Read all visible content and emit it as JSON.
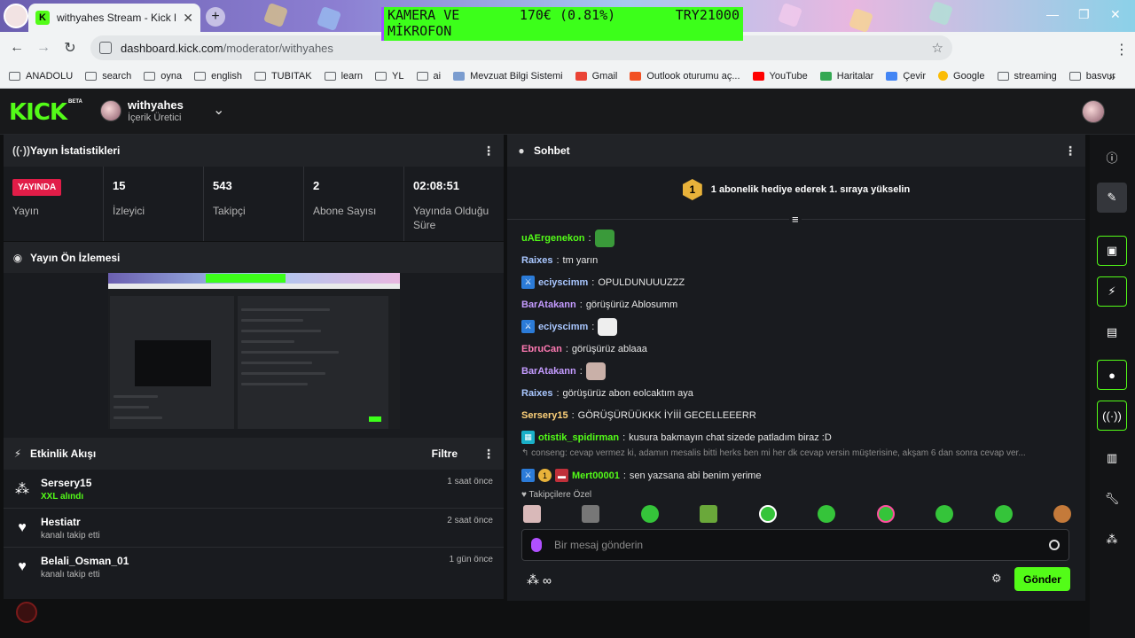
{
  "browser": {
    "tab_title": "withyahes Stream - Kick Dashbo",
    "tab_favicon": "K",
    "url_host": "dashboard.kick.com",
    "url_path": "/moderator/withyahes",
    "overlay": {
      "line1_left": "KAMERA VE",
      "line1_mid": "170€ (0.81%)",
      "line1_right": "TRY21000",
      "line2": "MİKROFON"
    },
    "bookmarks": [
      "ANADOLU",
      "search",
      "oyna",
      "english",
      "TUBITAK",
      "learn",
      "YL",
      "ai",
      "Mevzuat Bilgi Sistemi",
      "Gmail",
      "Outlook oturumu aç...",
      "YouTube",
      "Haritalar",
      "Çevir",
      "Google",
      "streaming",
      "basvur"
    ]
  },
  "header": {
    "logo": "KICK",
    "beta": "BETA",
    "channel_name": "withyahes",
    "channel_role": "İçerik Üretici"
  },
  "stats_panel": {
    "title": "Yayın İstatistikleri",
    "live_badge": "YAYINDA",
    "live_label": "Yayın",
    "viewers_value": "15",
    "viewers_label": "İzleyici",
    "followers_value": "543",
    "followers_label": "Takipçi",
    "subs_value": "2",
    "subs_label": "Abone Sayısı",
    "uptime_value": "02:08:51",
    "uptime_label": "Yayında Olduğu Süre"
  },
  "preview_panel": {
    "title": "Yayın Ön İzlemesi"
  },
  "activity_panel": {
    "title": "Etkinlik Akışı",
    "filter_label": "Filtre",
    "items": [
      {
        "name": "Sersery15",
        "sub": "XXL alındı",
        "time": "1 saat önce",
        "icon": "gift-icon"
      },
      {
        "name": "Hestiatr",
        "sub": "kanalı takip etti",
        "time": "2 saat önce",
        "icon": "heart-icon"
      },
      {
        "name": "Belali_Osman_01",
        "sub": "kanalı takip etti",
        "time": "1 gün önce",
        "icon": "heart-icon"
      }
    ]
  },
  "chat": {
    "title": "Sohbet",
    "promo_rank": "1",
    "promo_text": "1 abonelik hediye ederek 1. sıraya yükselin",
    "messages": [
      {
        "user": "uAErgenekon",
        "text": "",
        "color": "#53fc18"
      },
      {
        "user": "Raixes",
        "text": "tm yarın",
        "color": "#a9c7ff"
      },
      {
        "user": "eciyscimm",
        "text": "OPULDUNUUUZZZ",
        "color": "#a9c7ff"
      },
      {
        "user": "BarAtakann",
        "text": "görüşürüz Ablosumm",
        "color": "#c49bff"
      },
      {
        "user": "eciyscimm",
        "text": "",
        "color": "#a9c7ff"
      },
      {
        "user": "EbruCan",
        "text": "görüşürüz ablaaa",
        "color": "#ff7ab3"
      },
      {
        "user": "BarAtakann",
        "text": "",
        "color": "#c49bff"
      },
      {
        "user": "Raixes",
        "text": "görüşürüz abon eolcaktım aya",
        "color": "#a9c7ff"
      },
      {
        "user": "Sersery15",
        "text": "GÖRÜŞÜRÜÜKKK İYİİİ GECELLEEERR",
        "color": "#ffd27a"
      },
      {
        "user": "otistik_spidirman",
        "text": "kusura bakmayın chat sizede patladım biraz :D",
        "color": "#53fc18"
      }
    ],
    "reply_context": "conseng: cevap vermez ki, adamın mesalis bitti herks ben mi her dk cevap versin müşterisine, akşam 6 dan sonra cevap ver...",
    "reply_rank": "1",
    "reply_user": "Mert00001",
    "reply_text": "sen yazsana abi benim yerime",
    "followers_only": "Takipçilere Özel",
    "input_placeholder": "Bir mesaj gönderin",
    "send_label": "Gönder",
    "infinity": "∞"
  },
  "colors": {
    "kick_green": "#53fc18",
    "live_red": "#e11d48",
    "panel": "#191b1f"
  }
}
